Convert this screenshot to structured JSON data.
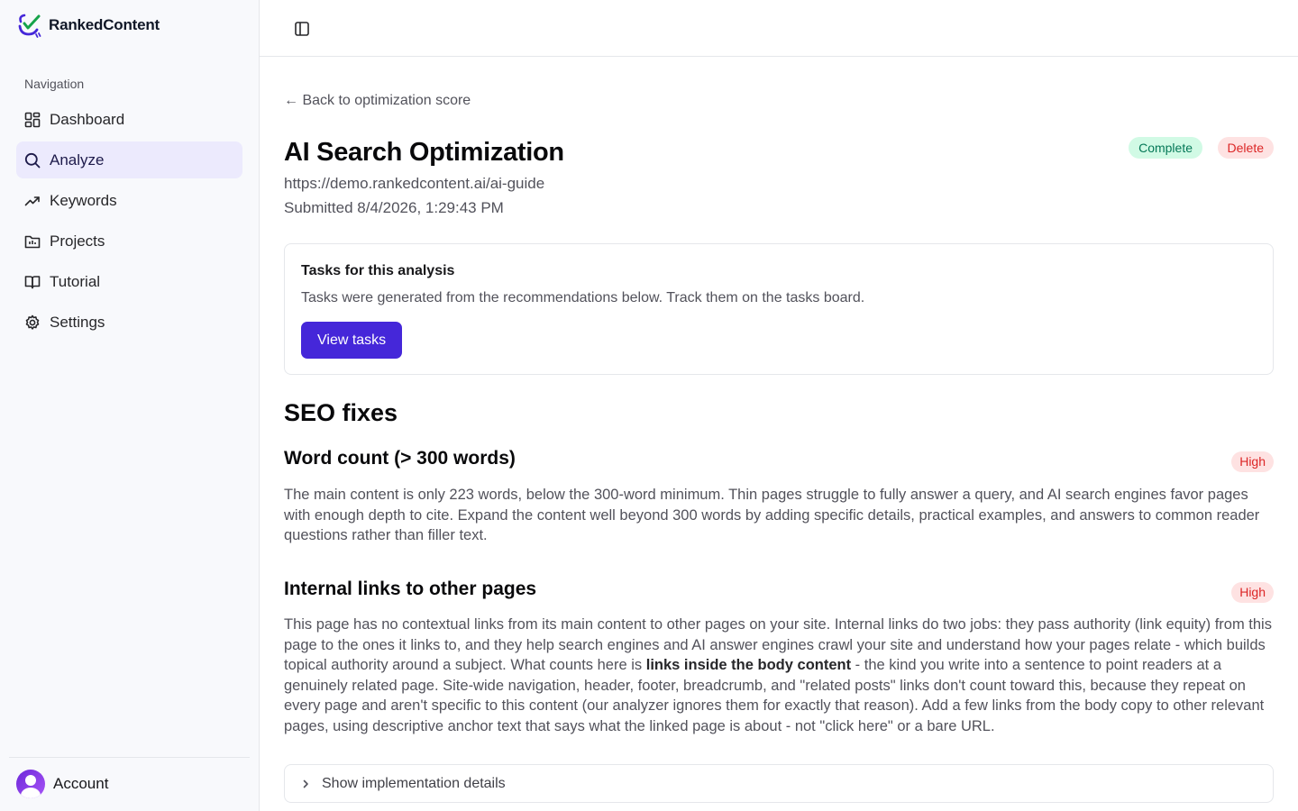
{
  "brand": {
    "name": "RankedContent"
  },
  "sidebar": {
    "heading": "Navigation",
    "items": [
      {
        "label": "Dashboard",
        "icon": "dashboard-icon",
        "active": false
      },
      {
        "label": "Analyze",
        "icon": "search-icon",
        "active": true
      },
      {
        "label": "Keywords",
        "icon": "trending-up-icon",
        "active": false
      },
      {
        "label": "Projects",
        "icon": "folder-icon",
        "active": false
      },
      {
        "label": "Tutorial",
        "icon": "book-icon",
        "active": false
      },
      {
        "label": "Settings",
        "icon": "gear-icon",
        "active": false
      }
    ],
    "account_label": "Account"
  },
  "page": {
    "back_link": "← Back to optimization score",
    "title": "AI Search Optimization",
    "url": "https://demo.rankedcontent.ai/ai-guide",
    "submitted": "Submitted 8/4/2026, 1:29:43 PM",
    "status": "Complete",
    "delete_label": "Delete"
  },
  "tasks_card": {
    "title": "Tasks for this analysis",
    "description": "Tasks were generated from the recommendations below. Track them on the tasks board.",
    "button_label": "View tasks"
  },
  "seo": {
    "section_title": "SEO fixes",
    "fixes": [
      {
        "title": "Word count (> 300 words)",
        "priority": "High",
        "body": "The main content is only 223 words, below the 300-word minimum. Thin pages struggle to fully answer a query, and AI search engines favor pages with enough depth to cite. Expand the content well beyond 300 words by adding specific details, practical examples, and answers to common reader questions rather than filler text."
      },
      {
        "title": "Internal links to other pages",
        "priority": "High",
        "body_before": "This page has no contextual links from its main content to other pages on your site. Internal links do two jobs: they pass authority (link equity) from this page to the ones it links to, and they help search engines and AI answer engines crawl your site and understand how your pages relate - which builds topical authority around a subject. What counts here is ",
        "body_bold": "links inside the body content",
        "body_after": " - the kind you write into a sentence to point readers at a genuinely related page. Site-wide navigation, header, footer, breadcrumb, and \"related posts\" links don't count toward this, because they repeat on every page and aren't specific to this content (our analyzer ignores them for exactly that reason). Add a few links from the body copy to other relevant pages, using descriptive anchor text that says what the linked page is about - not \"click here\" or a bare URL.",
        "details_label": "Show implementation details"
      }
    ]
  },
  "colors": {
    "accent": "#4527d9",
    "active_nav_bg": "#eceafd",
    "complete_bg": "#d1fae5",
    "complete_text": "#047857",
    "danger_bg": "#fee2e2",
    "danger_text": "#dc2626"
  }
}
